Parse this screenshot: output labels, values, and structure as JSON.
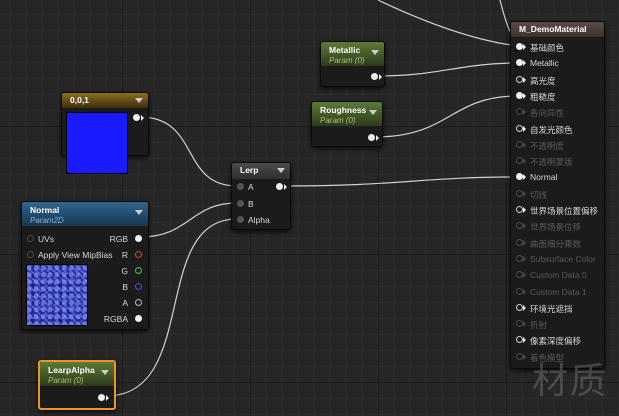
{
  "nodes": {
    "metallic": {
      "title": "Metallic",
      "subtitle": "Param (0)"
    },
    "roughness": {
      "title": "Roughness",
      "subtitle": "Param (0)"
    },
    "constant": {
      "title": "0,0,1",
      "color": "#1a1aff"
    },
    "lerp": {
      "title": "Lerp",
      "inputs": [
        "A",
        "B",
        "Alpha"
      ]
    },
    "normal": {
      "title": "Normal",
      "subtitle": "Param2D",
      "inputs": [
        "UVs",
        "Apply View MipBias"
      ],
      "outputs": [
        "RGB",
        "R",
        "G",
        "B",
        "A",
        "RGBA"
      ]
    },
    "lerp_alpha": {
      "title": "LearpAlpha",
      "subtitle": "Param (0)"
    },
    "material": {
      "title": "M_DemoMaterial",
      "pins": [
        {
          "label": "基础颜色",
          "enabled": true,
          "connected": true
        },
        {
          "label": "Metallic",
          "enabled": true,
          "connected": true
        },
        {
          "label": "高光度",
          "enabled": true,
          "connected": false
        },
        {
          "label": "粗糙度",
          "enabled": true,
          "connected": true
        },
        {
          "label": "各向异性",
          "enabled": false,
          "connected": false
        },
        {
          "label": "自发光颜色",
          "enabled": true,
          "connected": false
        },
        {
          "label": "不透明度",
          "enabled": false,
          "connected": false
        },
        {
          "label": "不透明蒙版",
          "enabled": false,
          "connected": false
        },
        {
          "label": "Normal",
          "enabled": true,
          "connected": true
        },
        {
          "label": "切线",
          "enabled": false,
          "connected": false
        },
        {
          "label": "世界场景位置偏移",
          "enabled": true,
          "connected": false
        },
        {
          "label": "世界场景位移",
          "enabled": false,
          "connected": false
        },
        {
          "label": "曲面细分乘数",
          "enabled": false,
          "connected": false
        },
        {
          "label": "Subsurface Color",
          "enabled": false,
          "connected": false
        },
        {
          "label": "Custom Data 0",
          "enabled": false,
          "connected": false
        },
        {
          "label": "Custom Data 1",
          "enabled": false,
          "connected": false
        },
        {
          "label": "环境光遮挡",
          "enabled": true,
          "connected": false
        },
        {
          "label": "折射",
          "enabled": false,
          "connected": false
        },
        {
          "label": "像素深度偏移",
          "enabled": true,
          "connected": false
        },
        {
          "label": "着色模型",
          "enabled": false,
          "connected": false
        }
      ]
    }
  },
  "watermark": "材质",
  "colors": {
    "param_header": "#5e7a36",
    "texture_header": "#2e6692",
    "constant_header": "#8b6d1e",
    "selected_outline": "#e8952a",
    "wire": "#d0d0d0"
  }
}
